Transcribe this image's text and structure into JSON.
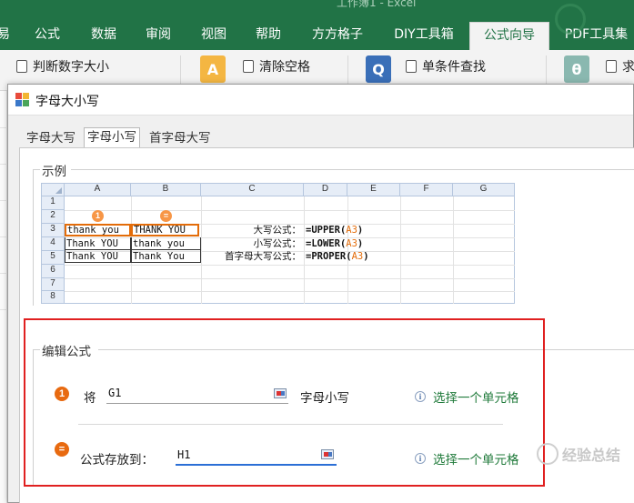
{
  "window": {
    "title_faded": "工作簿1 - Excel"
  },
  "ribbon_tabs": [
    {
      "label": "易"
    },
    {
      "label": "公式"
    },
    {
      "label": "数据"
    },
    {
      "label": "审阅"
    },
    {
      "label": "视图"
    },
    {
      "label": "帮助"
    },
    {
      "label": "方方格子"
    },
    {
      "label": "DIY工具箱"
    },
    {
      "label": "公式向导"
    },
    {
      "label": "PDF工具集"
    }
  ],
  "ribbon_items": {
    "judge_number": "判断数字大小",
    "clear_spaces": "清除空格",
    "single_lookup": "单条件查找",
    "sum_partial": "求"
  },
  "dialog": {
    "title": "字母大小写",
    "tabs": [
      {
        "label": "字母大写"
      },
      {
        "label": "字母小写"
      },
      {
        "label": "首字母大写"
      }
    ],
    "example_group": "示例",
    "edit_group": "编辑公式"
  },
  "example_sheet": {
    "columns": [
      "A",
      "B",
      "C",
      "D",
      "E",
      "F",
      "G"
    ],
    "rows": [
      "1",
      "2",
      "3",
      "4",
      "5",
      "6",
      "7",
      "8"
    ],
    "badges": [
      "1",
      "="
    ],
    "col_a": [
      "thank you",
      "Thank YOU",
      "Thank YOU"
    ],
    "col_b": [
      "THANK YOU",
      "thank you",
      "Thank You"
    ],
    "labels": [
      "大写公式：",
      "小写公式：",
      "首字母大写公式："
    ],
    "formulas": [
      {
        "pre": "=",
        "fn": "UPPER",
        "open": "(",
        "ref": "A3",
        "close": ")"
      },
      {
        "pre": "=",
        "fn": "LOWER",
        "open": "(",
        "ref": "A3",
        "close": ")"
      },
      {
        "pre": "=",
        "fn": "PROPER",
        "open": "(",
        "ref": "A3",
        "close": ")"
      }
    ]
  },
  "edit": {
    "step1_icon": "1",
    "step2_icon": "=",
    "row1_label": "将",
    "row1_value": "G1",
    "row1_suffix": "字母小写",
    "row2_label": "公式存放到：",
    "row2_value": "H1",
    "hint_text": "选择一个单元格",
    "info_glyph": "i"
  },
  "watermark": "经验总结"
}
